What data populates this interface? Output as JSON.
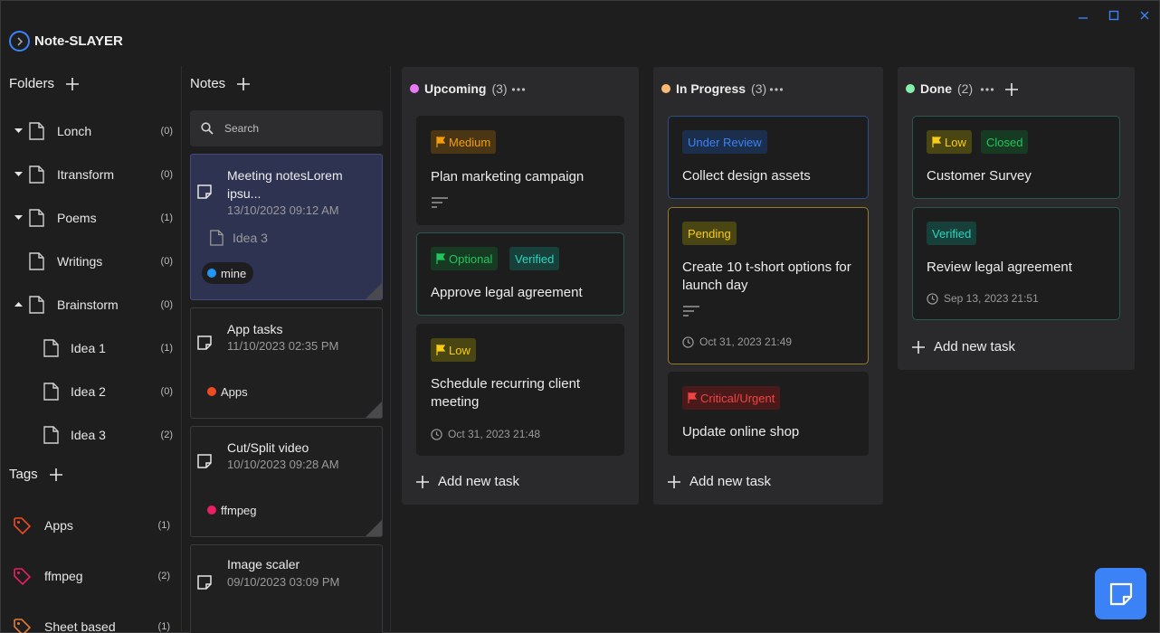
{
  "app": {
    "title": "Note-SLAYER"
  },
  "folders": {
    "heading": "Folders",
    "items": [
      {
        "label": "Lonch",
        "count": "(0)"
      },
      {
        "label": "Itransform",
        "count": "(0)"
      },
      {
        "label": "Poems",
        "count": "(1)"
      },
      {
        "label": "Writings",
        "count": "(0)"
      },
      {
        "label": "Brainstorm",
        "count": "(0)"
      },
      {
        "label": "Idea 1",
        "count": "(1)"
      },
      {
        "label": "Idea 2",
        "count": "(0)"
      },
      {
        "label": "Idea 3",
        "count": "(2)"
      }
    ]
  },
  "tags": {
    "heading": "Tags",
    "items": [
      {
        "label": "Apps",
        "count": "(1)",
        "color": "#f04a23"
      },
      {
        "label": "ffmpeg",
        "count": "(2)",
        "color": "#e91e63"
      },
      {
        "label": "Sheet based",
        "count": "(1)",
        "color": "#e07b39"
      }
    ]
  },
  "notes": {
    "heading": "Notes",
    "search_placeholder": "Search",
    "cards": [
      {
        "title": "Meeting notesLorem ipsu...",
        "date": "13/10/2023 09:12 AM",
        "folder": "Idea 3",
        "tag": "mine",
        "tag_color": "#2196f3"
      },
      {
        "title": "App tasks",
        "date": "11/10/2023 02:35 PM",
        "tag": "Apps",
        "tag_color": "#f04a23"
      },
      {
        "title": "Cut/Split video",
        "date": "10/10/2023 09:28 AM",
        "tag": "ffmpeg",
        "tag_color": "#e91e63"
      },
      {
        "title": "Image scaler",
        "date": "09/10/2023 03:09 PM"
      }
    ]
  },
  "board": {
    "add_task_label": "Add new task",
    "columns": [
      {
        "name": "Upcoming",
        "count": "(3)",
        "color": "#e879f9",
        "tasks": [
          {
            "badges": [
              {
                "text": "Medium",
                "flag": true,
                "fg": "#f59e0b",
                "bg": "#4a3614"
              }
            ],
            "title": "Plan marketing campaign"
          },
          {
            "badges": [
              {
                "text": "Optional",
                "flag": true,
                "fg": "#22c55e",
                "bg": "#163a22"
              },
              {
                "text": "Verified",
                "fg": "#2dd4bf",
                "bg": "#17403a"
              }
            ],
            "title": "Approve legal agreement"
          },
          {
            "badges": [
              {
                "text": "Low",
                "flag": true,
                "fg": "#facc15",
                "bg": "#4a4614"
              }
            ],
            "title": "Schedule recurring client meeting",
            "date": "Oct 31, 2023 21:48"
          }
        ]
      },
      {
        "name": "In Progress",
        "count": "(3)",
        "color": "#fdba74",
        "tasks": [
          {
            "badges": [
              {
                "text": "Under Review",
                "fg": "#3b82f6",
                "bg": "#1b2e4c"
              }
            ],
            "title": "Collect design assets"
          },
          {
            "badges": [
              {
                "text": "Pending",
                "fg": "#facc15",
                "bg": "#4a4614"
              }
            ],
            "title": "Create 10 t-short options for launch day",
            "date": "Oct 31, 2023 21:49"
          },
          {
            "badges": [
              {
                "text": "Critical/Urgent",
                "flag": true,
                "fg": "#ef4444",
                "bg": "#4a1a1a"
              }
            ],
            "title": "Update online shop"
          }
        ]
      },
      {
        "name": "Done",
        "count": "(2)",
        "color": "#86efac",
        "tasks": [
          {
            "badges": [
              {
                "text": "Low",
                "flag": true,
                "fg": "#facc15",
                "bg": "#4a4614"
              },
              {
                "text": "Closed",
                "fg": "#22c55e",
                "bg": "#163a22"
              }
            ],
            "title": "Customer Survey"
          },
          {
            "badges": [
              {
                "text": "Verified",
                "fg": "#2dd4bf",
                "bg": "#17403a"
              }
            ],
            "title": "Review legal agreement",
            "date": "Sep 13, 2023 21:51"
          }
        ]
      }
    ]
  }
}
